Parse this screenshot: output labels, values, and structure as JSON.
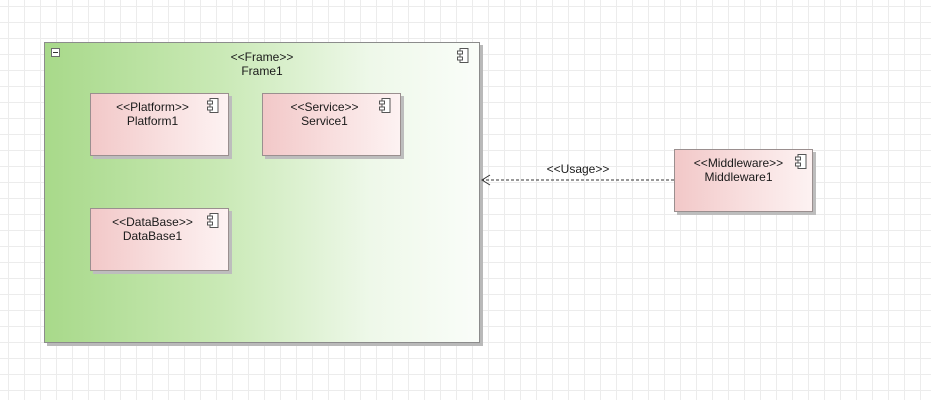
{
  "frame": {
    "stereotype": "<<Frame>>",
    "name": "Frame1"
  },
  "components": {
    "platform": {
      "stereotype": "<<Platform>>",
      "name": "Platform1"
    },
    "service": {
      "stereotype": "<<Service>>",
      "name": "Service1"
    },
    "database": {
      "stereotype": "<<DataBase>>",
      "name": "DataBase1"
    },
    "middleware": {
      "stereotype": "<<Middleware>>",
      "name": "Middleware1"
    }
  },
  "connector": {
    "label": "<<Usage>>",
    "style": "dashed",
    "direction": "Middleware1 -> Frame1"
  },
  "colors": {
    "frame_fill_start": "#a8d98a",
    "component_fill_start": "#f2c8c8",
    "grid": "#ececec"
  },
  "icons": [
    "collapse-icon",
    "component-icon"
  ]
}
